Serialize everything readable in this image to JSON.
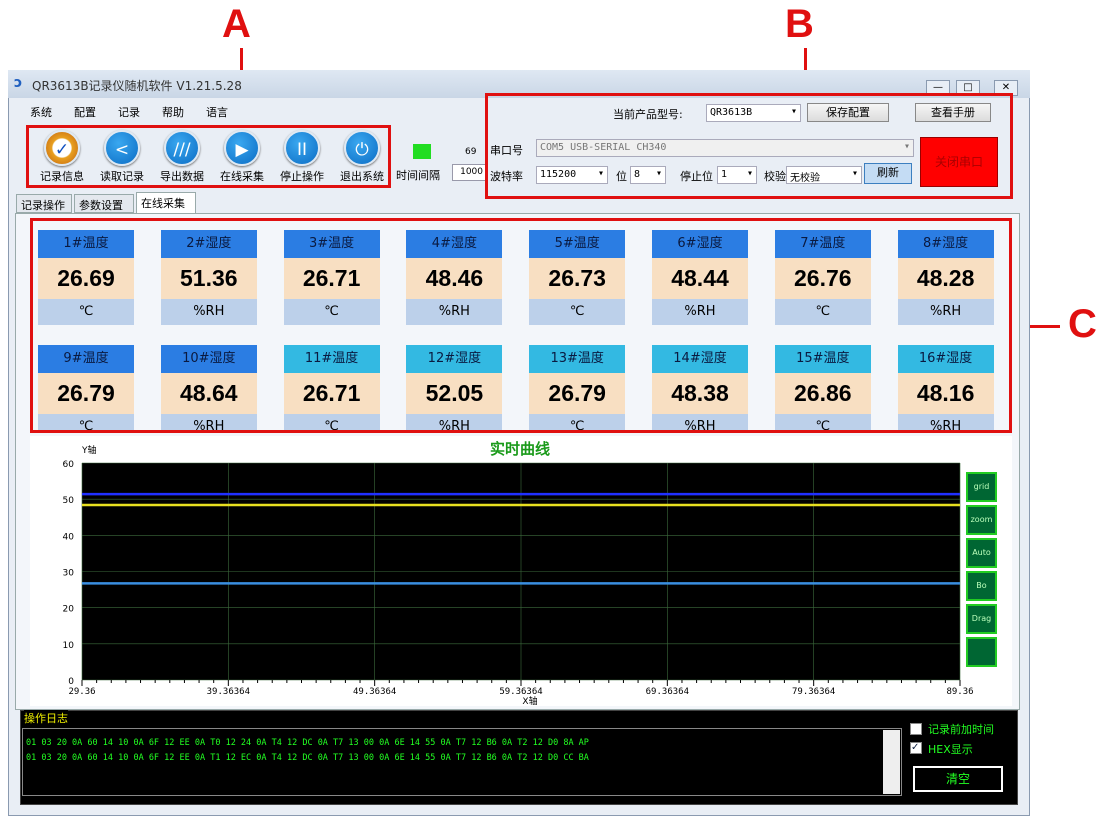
{
  "annotations": {
    "a": "A",
    "b": "B",
    "c": "C"
  },
  "window": {
    "title": "QR3613B记录仪随机软件  V1.21.5.28",
    "minimize": "—",
    "maximize": "□",
    "close": "✕"
  },
  "menu": [
    "系统",
    "配置",
    "记录",
    "帮助",
    "语言"
  ],
  "toolbar": [
    {
      "label": "记录信息",
      "icon": "record-info-icon",
      "glyph": "✓"
    },
    {
      "label": "读取记录",
      "icon": "share-icon",
      "glyph": "<"
    },
    {
      "label": "导出数据",
      "icon": "export-icon",
      "glyph": "///"
    },
    {
      "label": "在线采集",
      "icon": "play-icon",
      "glyph": "▶"
    },
    {
      "label": "停止操作",
      "icon": "pause-icon",
      "glyph": "II"
    },
    {
      "label": "退出系统",
      "icon": "power-icon",
      "glyph": "⏻"
    }
  ],
  "status": {
    "indicator_color": "#22dd22",
    "count": "69",
    "interval_label": "时间间隔",
    "interval_value": "1000"
  },
  "tabs": [
    "记录操作",
    "参数设置",
    "在线采集"
  ],
  "serial": {
    "model_label": "当前产品型号:",
    "model": "QR3613B",
    "save_config": "保存配置",
    "view_manual": "查看手册",
    "port_label": "串口号",
    "port": "COM5 USB-SERIAL CH340",
    "baud_label": "波特率",
    "baud": "115200",
    "bits_label": "位",
    "bits": "8",
    "stop_label": "停止位",
    "stop": "1",
    "parity_label": "校验",
    "parity": "无校验",
    "refresh": "刷新",
    "close_port": "关闭串口"
  },
  "channels": [
    {
      "name": "1#温度",
      "value": "26.69",
      "unit": "℃",
      "color": "#2b7de3"
    },
    {
      "name": "2#湿度",
      "value": "51.36",
      "unit": "%RH",
      "color": "#2b7de3"
    },
    {
      "name": "3#温度",
      "value": "26.71",
      "unit": "℃",
      "color": "#2b7de3"
    },
    {
      "name": "4#湿度",
      "value": "48.46",
      "unit": "%RH",
      "color": "#2b7de3"
    },
    {
      "name": "5#温度",
      "value": "26.73",
      "unit": "℃",
      "color": "#2b7de3"
    },
    {
      "name": "6#湿度",
      "value": "48.44",
      "unit": "%RH",
      "color": "#2b7de3"
    },
    {
      "name": "7#温度",
      "value": "26.76",
      "unit": "℃",
      "color": "#2b7de3"
    },
    {
      "name": "8#湿度",
      "value": "48.28",
      "unit": "%RH",
      "color": "#2b7de3"
    },
    {
      "name": "9#温度",
      "value": "26.79",
      "unit": "℃",
      "color": "#2b7de3"
    },
    {
      "name": "10#湿度",
      "value": "48.64",
      "unit": "%RH",
      "color": "#2b7de3"
    },
    {
      "name": "11#温度",
      "value": "26.71",
      "unit": "℃",
      "color": "#33b9e2"
    },
    {
      "name": "12#湿度",
      "value": "52.05",
      "unit": "%RH",
      "color": "#33b9e2"
    },
    {
      "name": "13#温度",
      "value": "26.79",
      "unit": "℃",
      "color": "#33b9e2"
    },
    {
      "name": "14#湿度",
      "value": "48.38",
      "unit": "%RH",
      "color": "#33b9e2"
    },
    {
      "name": "15#温度",
      "value": "26.86",
      "unit": "℃",
      "color": "#33b9e2"
    },
    {
      "name": "16#湿度",
      "value": "48.16",
      "unit": "%RH",
      "color": "#33b9e2"
    }
  ],
  "chart_data": {
    "type": "line",
    "title": "实时曲线",
    "xlabel": "X轴",
    "ylabel": "Y轴",
    "xlim": [
      29.36,
      89.36
    ],
    "ylim": [
      0,
      60
    ],
    "yticks": [
      "0",
      "10",
      "20",
      "30",
      "40",
      "50",
      "60"
    ],
    "xticks": [
      "29.36",
      "39.36364",
      "49.36364",
      "59.36364",
      "69.36364",
      "79.36364",
      "89.36"
    ],
    "grid": true,
    "series": [
      {
        "name": "blue",
        "color": "#2030ff",
        "x": [
          29.36,
          89.36
        ],
        "y": [
          51.4,
          51.4
        ]
      },
      {
        "name": "yellow",
        "color": "#e8e020",
        "x": [
          29.36,
          89.36
        ],
        "y": [
          48.4,
          48.4
        ]
      },
      {
        "name": "lightblue",
        "color": "#3a8ee0",
        "x": [
          29.36,
          89.36
        ],
        "y": [
          26.7,
          26.7
        ]
      }
    ]
  },
  "chart_tools": [
    "grid",
    "zoom",
    "Auto",
    "Bo",
    "Drag",
    ""
  ],
  "log": {
    "title": "操作日志",
    "lines": [
      "01 03 20 0A 60 14 10 0A 6F 12 EE 0A T0 12 24 0A T4 12 DC 0A T7 13 00 0A 6E 14 55 0A T7 12 B6 0A T2 12 D0 8A AP",
      "01 03 20 0A 60 14 10 0A 6F 12 EE 0A T1 12 EC 0A T4 12 DC 0A T7 13 00 0A 6E 14 55 0A T7 12 B6 0A T2 12 D0 CC BA"
    ],
    "add_time_label": "记录前加时间",
    "hex_label": "HEX显示",
    "add_time": false,
    "hex": true,
    "clear": "清空"
  }
}
